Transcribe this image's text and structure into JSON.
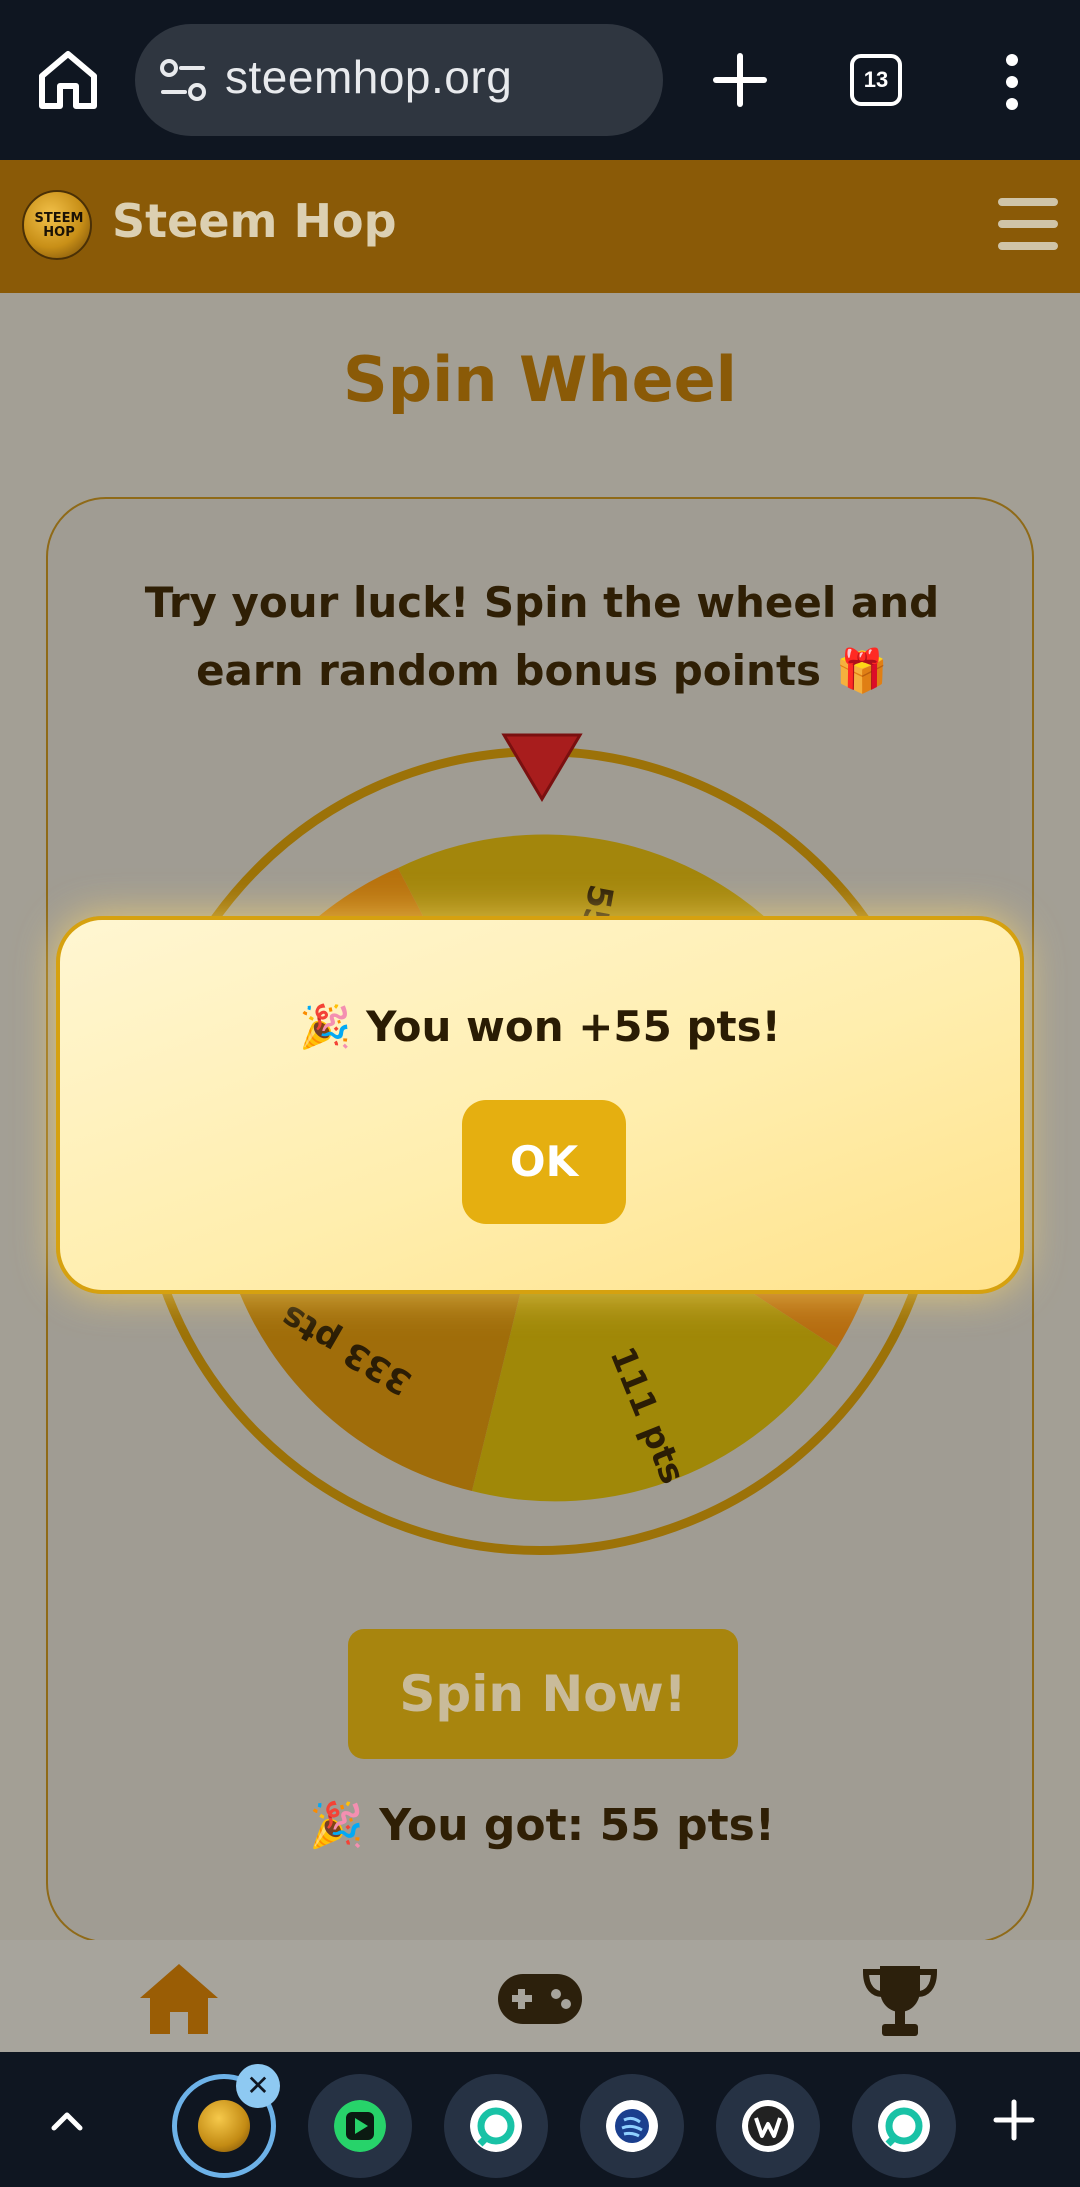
{
  "browser": {
    "url": "steemhop.org",
    "tab_count": "13"
  },
  "site": {
    "logo_text": [
      "STEEM",
      "HOP"
    ],
    "name": "Steem Hop"
  },
  "page": {
    "title": "Spin Wheel",
    "intro": "Try your luck! Spin the wheel and earn random bonus points 🎁",
    "wheel_labels": [
      "55 pts",
      "333 pts",
      "111 pts"
    ],
    "spin_button": "Spin Now!",
    "result": "🎉 You got: 55 pts!"
  },
  "modal": {
    "message": "🎉 You won +55 pts!",
    "ok_label": "OK"
  },
  "colors": {
    "header": "#8a5a07",
    "accent": "#e5af10",
    "modal_bg": "#ffeeae",
    "browser_bg": "#0f1621"
  },
  "nav_icons": [
    "home-icon",
    "gamepad-icon",
    "trophy-icon"
  ],
  "tab_strip": {
    "icons": [
      "steemhop-logo-icon",
      "play-app-icon",
      "chat-app-icon",
      "steem-app-icon",
      "w-app-icon",
      "chat-app-icon"
    ]
  }
}
